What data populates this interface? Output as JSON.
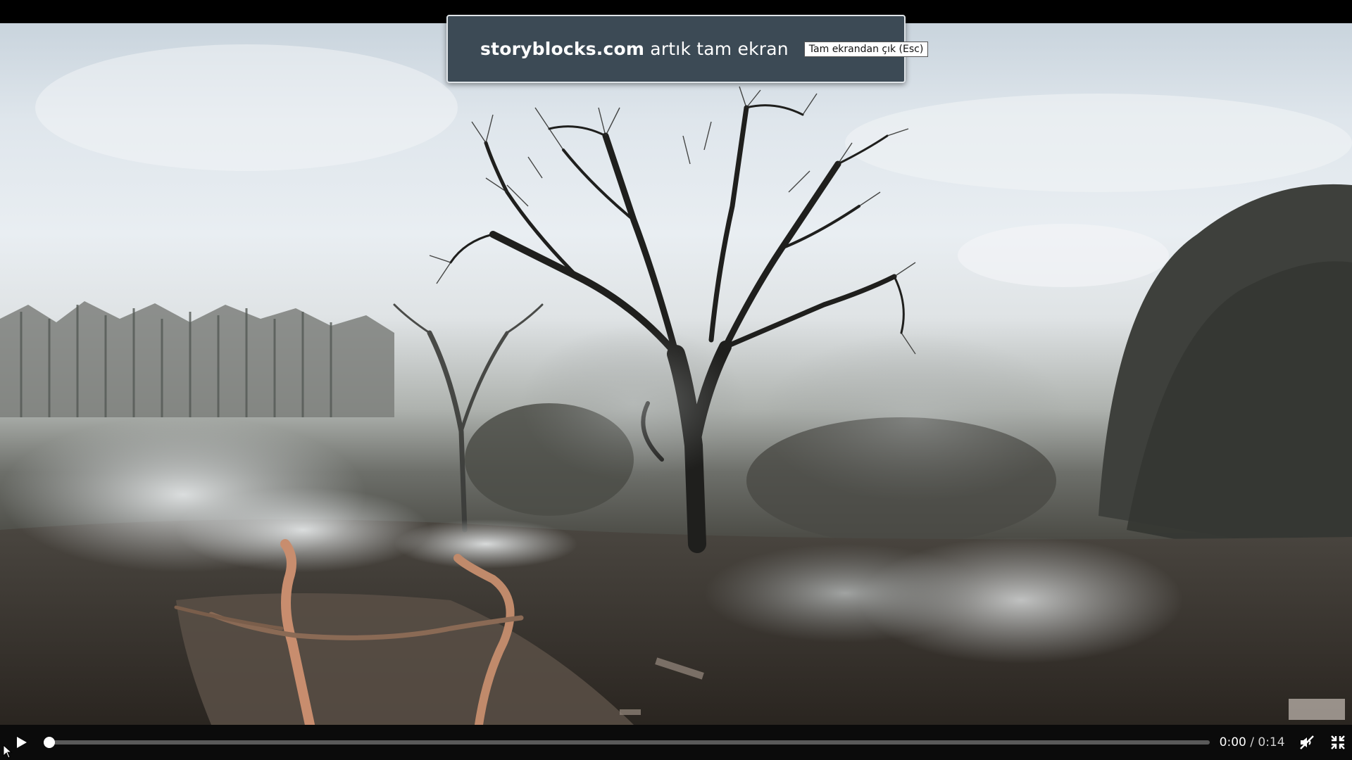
{
  "fullscreen_notice": {
    "domain": "storyblocks.com",
    "message": "artık tam ekran",
    "exit_button": "Tam ekrandan çık (Esc)"
  },
  "player": {
    "current_time": "0:00",
    "separator": "/",
    "duration": "0:14",
    "progress_fraction": 0.0
  },
  "icons": {
    "lock": "lock-icon",
    "play": "play-icon",
    "mute": "volume-muted-icon",
    "exit_fullscreen": "exit-fullscreen-icon",
    "cursor": "mouse-cursor-icon"
  }
}
